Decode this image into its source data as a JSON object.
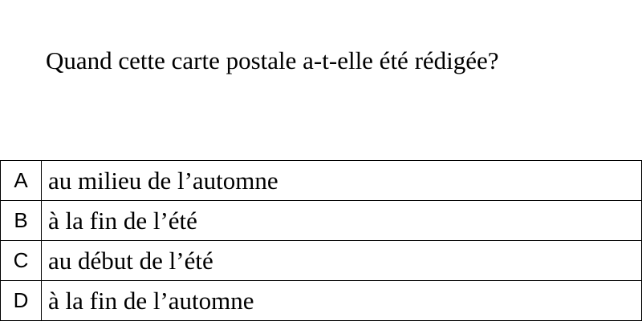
{
  "question": "Quand cette carte postale a-t-elle été rédigée?",
  "options": [
    {
      "letter": "A",
      "text": "au milieu de l’automne"
    },
    {
      "letter": "B",
      "text": "à la fin de l’été"
    },
    {
      "letter": "C",
      "text": "au début de l’été"
    },
    {
      "letter": "D",
      "text": "à la fin de l’automne"
    }
  ]
}
